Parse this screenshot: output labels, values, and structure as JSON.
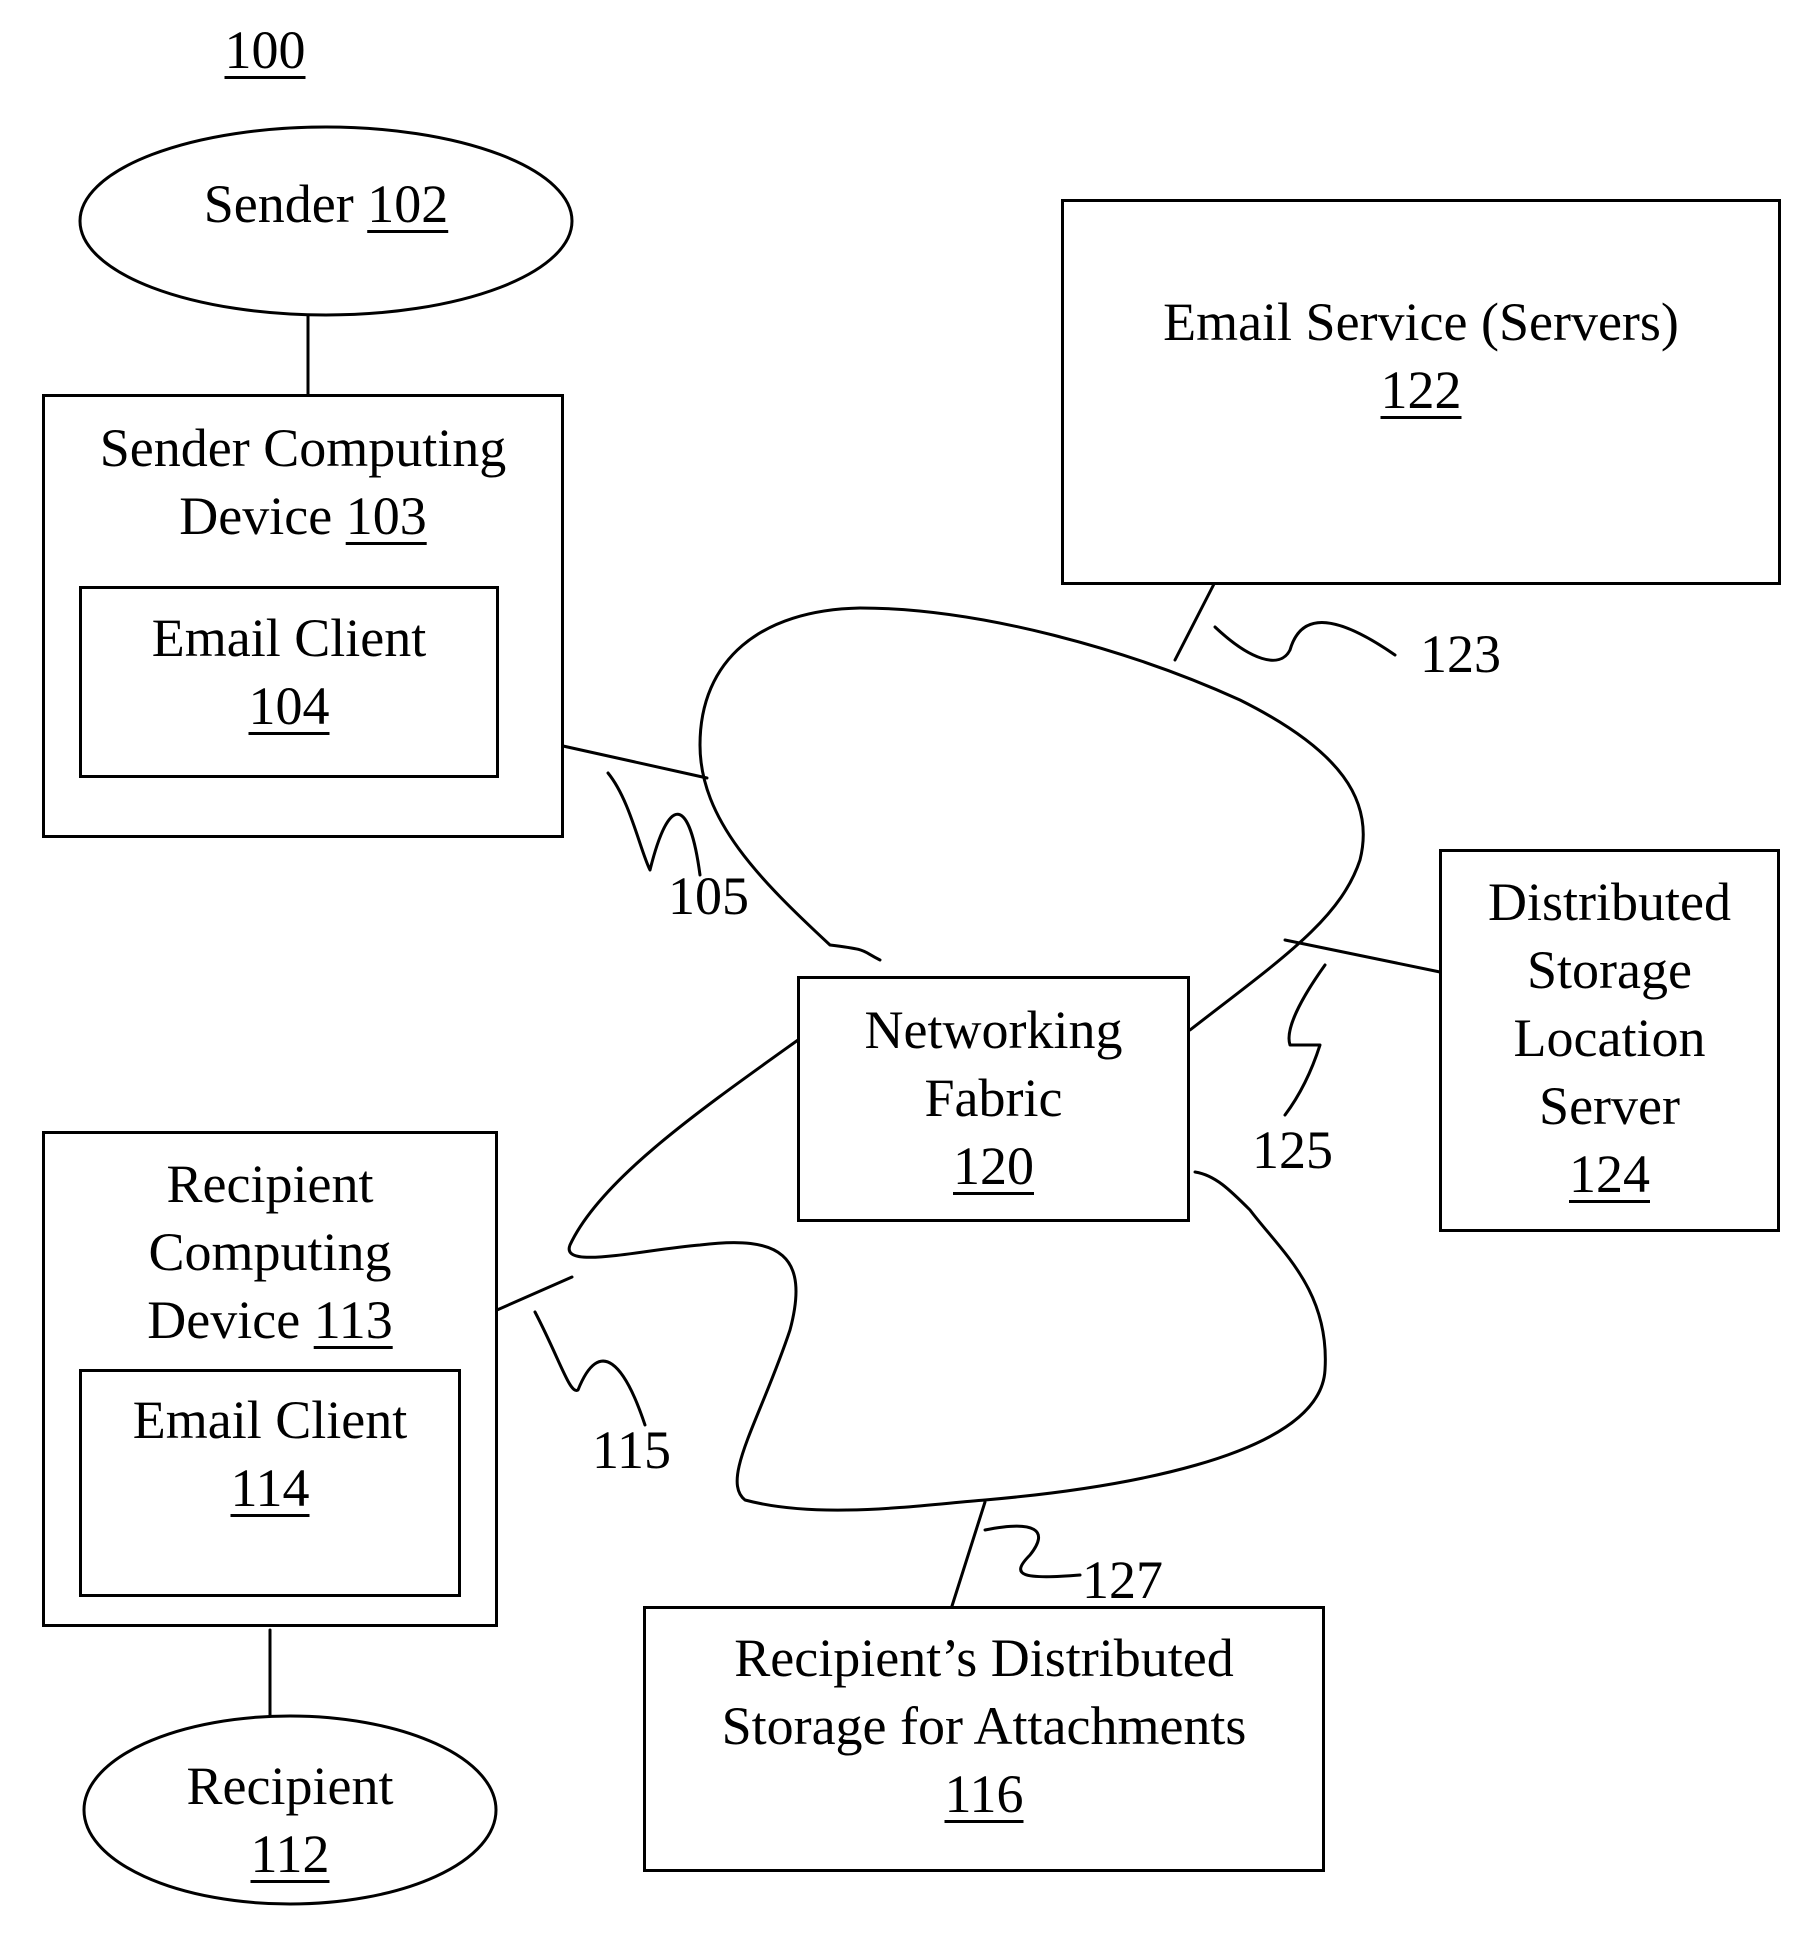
{
  "figure": {
    "ref": "100"
  },
  "nodes": {
    "sender": {
      "label": "Sender",
      "ref": "102"
    },
    "sender_device": {
      "label_line1": "Sender Computing",
      "label_line2": "Device",
      "ref": "103"
    },
    "sender_email_client": {
      "label": "Email Client",
      "ref": "104"
    },
    "email_service": {
      "label": "Email Service (Servers)",
      "ref": "122"
    },
    "networking_fabric": {
      "label_line1": "Networking",
      "label_line2": "Fabric",
      "ref": "120"
    },
    "dslocation_server": {
      "line1": "Distributed",
      "line2": "Storage",
      "line3": "Location",
      "line4": "Server",
      "ref": "124"
    },
    "recipient_device": {
      "line1": "Recipient",
      "line2": "Computing",
      "line3": "Device",
      "ref": "113"
    },
    "recipient_email_client": {
      "label": "Email Client",
      "ref": "114"
    },
    "recipient": {
      "label": "Recipient",
      "ref": "112"
    },
    "recipient_storage": {
      "line1": "Recipient’s Distributed",
      "line2": "Storage for Attachments",
      "ref": "116"
    }
  },
  "connections": {
    "c105": "105",
    "c115": "115",
    "c123": "123",
    "c125": "125",
    "c127": "127"
  }
}
